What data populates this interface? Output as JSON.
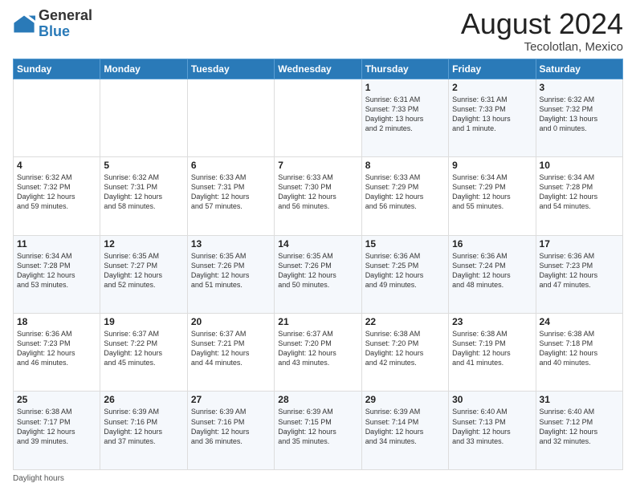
{
  "header": {
    "logo_general": "General",
    "logo_blue": "Blue",
    "month_year": "August 2024",
    "location": "Tecolotlan, Mexico"
  },
  "footer": {
    "daylight_hours_label": "Daylight hours"
  },
  "days_of_week": [
    "Sunday",
    "Monday",
    "Tuesday",
    "Wednesday",
    "Thursday",
    "Friday",
    "Saturday"
  ],
  "weeks": [
    [
      {
        "num": "",
        "info": ""
      },
      {
        "num": "",
        "info": ""
      },
      {
        "num": "",
        "info": ""
      },
      {
        "num": "",
        "info": ""
      },
      {
        "num": "1",
        "info": "Sunrise: 6:31 AM\nSunset: 7:33 PM\nDaylight: 13 hours\nand 2 minutes."
      },
      {
        "num": "2",
        "info": "Sunrise: 6:31 AM\nSunset: 7:33 PM\nDaylight: 13 hours\nand 1 minute."
      },
      {
        "num": "3",
        "info": "Sunrise: 6:32 AM\nSunset: 7:32 PM\nDaylight: 13 hours\nand 0 minutes."
      }
    ],
    [
      {
        "num": "4",
        "info": "Sunrise: 6:32 AM\nSunset: 7:32 PM\nDaylight: 12 hours\nand 59 minutes."
      },
      {
        "num": "5",
        "info": "Sunrise: 6:32 AM\nSunset: 7:31 PM\nDaylight: 12 hours\nand 58 minutes."
      },
      {
        "num": "6",
        "info": "Sunrise: 6:33 AM\nSunset: 7:31 PM\nDaylight: 12 hours\nand 57 minutes."
      },
      {
        "num": "7",
        "info": "Sunrise: 6:33 AM\nSunset: 7:30 PM\nDaylight: 12 hours\nand 56 minutes."
      },
      {
        "num": "8",
        "info": "Sunrise: 6:33 AM\nSunset: 7:29 PM\nDaylight: 12 hours\nand 56 minutes."
      },
      {
        "num": "9",
        "info": "Sunrise: 6:34 AM\nSunset: 7:29 PM\nDaylight: 12 hours\nand 55 minutes."
      },
      {
        "num": "10",
        "info": "Sunrise: 6:34 AM\nSunset: 7:28 PM\nDaylight: 12 hours\nand 54 minutes."
      }
    ],
    [
      {
        "num": "11",
        "info": "Sunrise: 6:34 AM\nSunset: 7:28 PM\nDaylight: 12 hours\nand 53 minutes."
      },
      {
        "num": "12",
        "info": "Sunrise: 6:35 AM\nSunset: 7:27 PM\nDaylight: 12 hours\nand 52 minutes."
      },
      {
        "num": "13",
        "info": "Sunrise: 6:35 AM\nSunset: 7:26 PM\nDaylight: 12 hours\nand 51 minutes."
      },
      {
        "num": "14",
        "info": "Sunrise: 6:35 AM\nSunset: 7:26 PM\nDaylight: 12 hours\nand 50 minutes."
      },
      {
        "num": "15",
        "info": "Sunrise: 6:36 AM\nSunset: 7:25 PM\nDaylight: 12 hours\nand 49 minutes."
      },
      {
        "num": "16",
        "info": "Sunrise: 6:36 AM\nSunset: 7:24 PM\nDaylight: 12 hours\nand 48 minutes."
      },
      {
        "num": "17",
        "info": "Sunrise: 6:36 AM\nSunset: 7:23 PM\nDaylight: 12 hours\nand 47 minutes."
      }
    ],
    [
      {
        "num": "18",
        "info": "Sunrise: 6:36 AM\nSunset: 7:23 PM\nDaylight: 12 hours\nand 46 minutes."
      },
      {
        "num": "19",
        "info": "Sunrise: 6:37 AM\nSunset: 7:22 PM\nDaylight: 12 hours\nand 45 minutes."
      },
      {
        "num": "20",
        "info": "Sunrise: 6:37 AM\nSunset: 7:21 PM\nDaylight: 12 hours\nand 44 minutes."
      },
      {
        "num": "21",
        "info": "Sunrise: 6:37 AM\nSunset: 7:20 PM\nDaylight: 12 hours\nand 43 minutes."
      },
      {
        "num": "22",
        "info": "Sunrise: 6:38 AM\nSunset: 7:20 PM\nDaylight: 12 hours\nand 42 minutes."
      },
      {
        "num": "23",
        "info": "Sunrise: 6:38 AM\nSunset: 7:19 PM\nDaylight: 12 hours\nand 41 minutes."
      },
      {
        "num": "24",
        "info": "Sunrise: 6:38 AM\nSunset: 7:18 PM\nDaylight: 12 hours\nand 40 minutes."
      }
    ],
    [
      {
        "num": "25",
        "info": "Sunrise: 6:38 AM\nSunset: 7:17 PM\nDaylight: 12 hours\nand 39 minutes."
      },
      {
        "num": "26",
        "info": "Sunrise: 6:39 AM\nSunset: 7:16 PM\nDaylight: 12 hours\nand 37 minutes."
      },
      {
        "num": "27",
        "info": "Sunrise: 6:39 AM\nSunset: 7:16 PM\nDaylight: 12 hours\nand 36 minutes."
      },
      {
        "num": "28",
        "info": "Sunrise: 6:39 AM\nSunset: 7:15 PM\nDaylight: 12 hours\nand 35 minutes."
      },
      {
        "num": "29",
        "info": "Sunrise: 6:39 AM\nSunset: 7:14 PM\nDaylight: 12 hours\nand 34 minutes."
      },
      {
        "num": "30",
        "info": "Sunrise: 6:40 AM\nSunset: 7:13 PM\nDaylight: 12 hours\nand 33 minutes."
      },
      {
        "num": "31",
        "info": "Sunrise: 6:40 AM\nSunset: 7:12 PM\nDaylight: 12 hours\nand 32 minutes."
      }
    ]
  ]
}
